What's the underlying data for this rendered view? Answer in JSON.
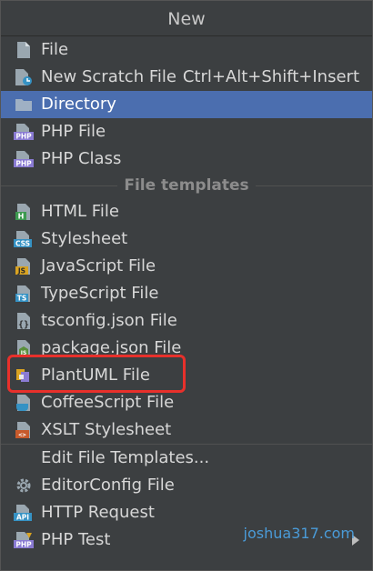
{
  "window": {
    "title": "New"
  },
  "items_top": [
    {
      "label": "File",
      "icon": "file-icon"
    },
    {
      "label": "New Scratch File",
      "icon": "scratch-file-icon",
      "shortcut": "Ctrl+Alt+Shift+Insert"
    },
    {
      "label": "Directory",
      "icon": "folder-icon",
      "selected": true
    },
    {
      "label": "PHP File",
      "icon": "php-file-icon"
    },
    {
      "label": "PHP Class",
      "icon": "php-class-icon"
    }
  ],
  "section_title": "File templates",
  "templates": [
    {
      "label": "HTML File",
      "icon": "html-file-icon"
    },
    {
      "label": "Stylesheet",
      "icon": "css-file-icon"
    },
    {
      "label": "JavaScript File",
      "icon": "js-file-icon"
    },
    {
      "label": "TypeScript File",
      "icon": "ts-file-icon"
    },
    {
      "label": "tsconfig.json File",
      "icon": "tsconfig-file-icon"
    },
    {
      "label": "package.json File",
      "icon": "package-json-icon"
    },
    {
      "label": "PlantUML File",
      "icon": "plantuml-file-icon",
      "highlighted": true
    },
    {
      "label": "CoffeeScript File",
      "icon": "coffeescript-file-icon"
    },
    {
      "label": "XSLT Stylesheet",
      "icon": "xslt-file-icon"
    }
  ],
  "items_bottom": [
    {
      "label": "Edit File Templates...",
      "icon": ""
    },
    {
      "label": "EditorConfig File",
      "icon": "gear-icon"
    },
    {
      "label": "HTTP Request",
      "icon": "api-icon"
    },
    {
      "label": "PHP Test",
      "icon": "php-test-icon",
      "submenu": true
    }
  ],
  "watermark": "joshua317.com",
  "colors": {
    "selected_bg": "#4b6eaf",
    "popup_bg": "#3c3f41",
    "highlight_border": "#e8302b",
    "watermark": "#4a9bd8"
  }
}
